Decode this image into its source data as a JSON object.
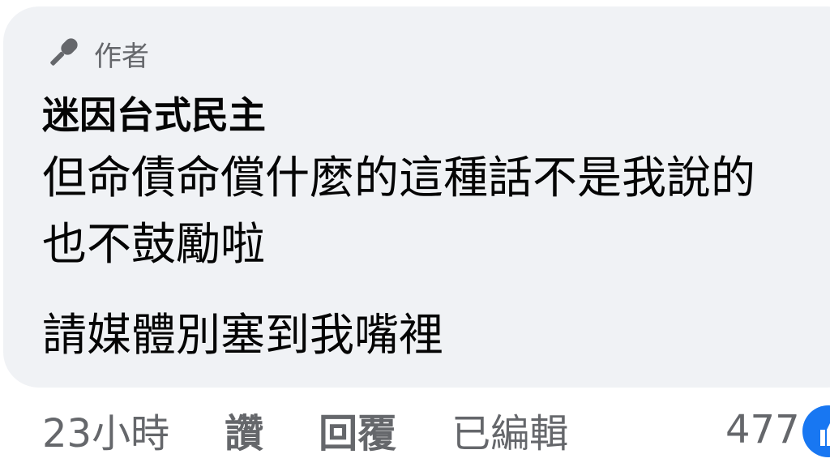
{
  "comment": {
    "author_badge": {
      "icon": "microphone-icon",
      "label": "作者"
    },
    "author_name": "迷因台式民主",
    "text_lines": [
      "但命債命償什麼的這種話不是我說的",
      "也不鼓勵啦",
      "請媒體別塞到我嘴裡"
    ],
    "timestamp": "23小時",
    "actions": {
      "like": "讚",
      "reply": "回覆",
      "edited": "已編輯"
    },
    "reaction_count": "477",
    "reaction_icon": "like-reaction-icon",
    "colors": {
      "bubble": "#f0f2f5",
      "text": "#050505",
      "secondary": "#65676b",
      "reaction": "#1877f2"
    }
  }
}
